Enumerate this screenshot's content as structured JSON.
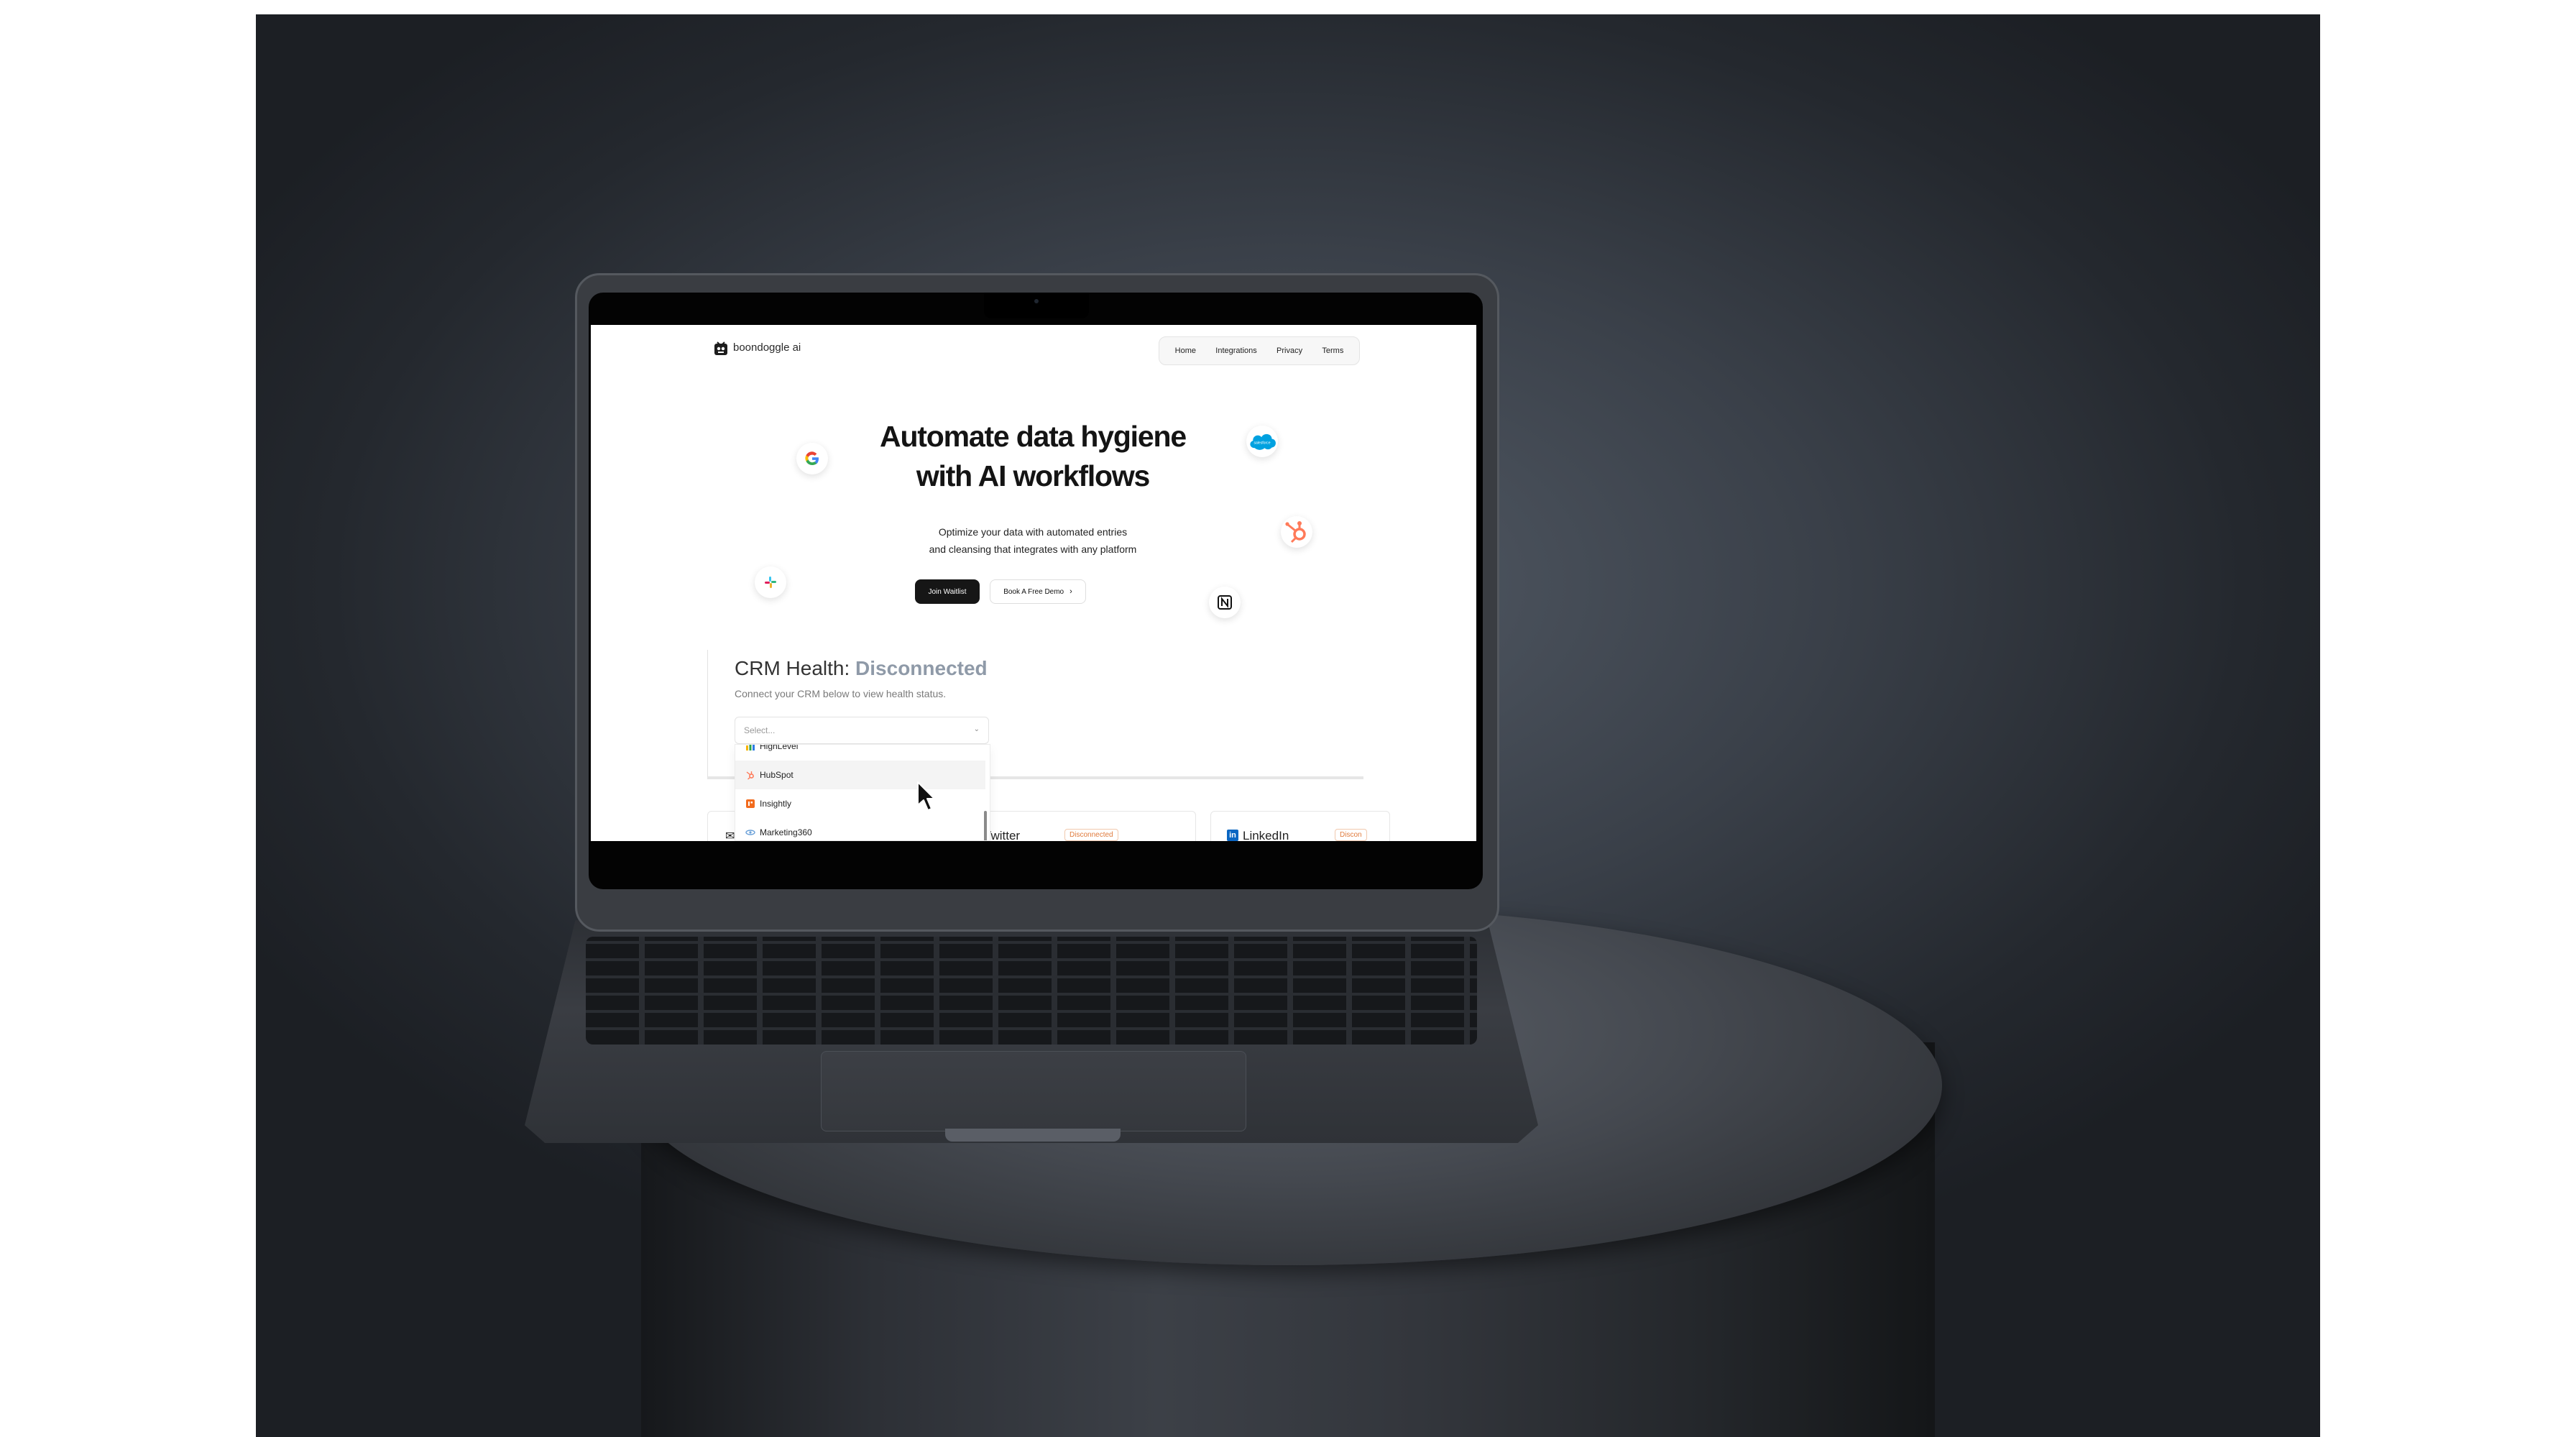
{
  "brand": {
    "name": "boondoggle ai"
  },
  "nav": {
    "items": [
      "Home",
      "Integrations",
      "Privacy",
      "Terms"
    ]
  },
  "hero": {
    "title_line1": "Automate data hygiene",
    "title_line2": "with AI workflows",
    "subtitle_line1": "Optimize your data with automated entries",
    "subtitle_line2": "and cleansing that integrates with any platform",
    "primary_button": "Join Waitlist",
    "secondary_button": "Book A Free Demo",
    "floating_icons": [
      "google-icon",
      "salesforce-icon",
      "hubspot-icon",
      "slack-icon",
      "notion-icon"
    ]
  },
  "salesforce_badge_text": "salesforce",
  "crm": {
    "title_prefix": "CRM Health:",
    "status": "Disconnected",
    "description": "Connect your CRM below to view health status.",
    "select_placeholder": "Select...",
    "options": [
      {
        "label": "HighLevel",
        "icon": "highlevel-icon"
      },
      {
        "label": "HubSpot",
        "icon": "hubspot-icon"
      },
      {
        "label": "Insightly",
        "icon": "insightly-icon"
      },
      {
        "label": "Marketing360",
        "icon": "marketing360-icon"
      }
    ],
    "hovered_option": "HubSpot"
  },
  "integrations": [
    {
      "name": "Twitter",
      "status": "Disconnected"
    },
    {
      "name": "LinkedIn",
      "status": "Discon"
    }
  ],
  "colors": {
    "status_gray": "#8f9aa8",
    "badge_orange": "#e07a3c",
    "hubspot_orange": "#ff7a59",
    "salesforce_blue": "#00a1e0",
    "linkedin_blue": "#0a66c2"
  }
}
